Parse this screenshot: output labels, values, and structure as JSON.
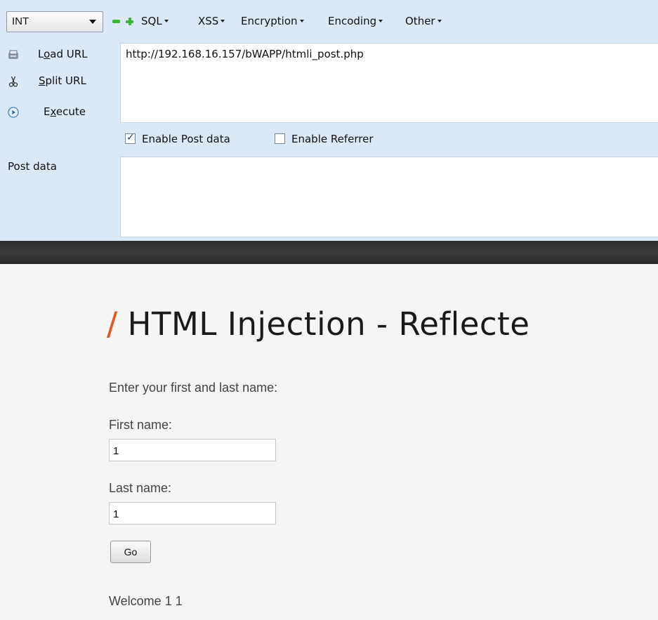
{
  "hackbar": {
    "select_value": "INT",
    "menus": [
      "SQL",
      "XSS",
      "Encryption",
      "Encoding",
      "Other"
    ],
    "load_url": "Load URL",
    "split_url": "Split URL",
    "execute": "Execute",
    "url_value": "http://192.168.16.157/bWAPP/htmli_post.php",
    "enable_post": "Enable Post data",
    "enable_post_checked": true,
    "enable_referrer": "Enable Referrer",
    "enable_referrer_checked": false,
    "post_label": "Post data",
    "post_value": ""
  },
  "page": {
    "title_slash": "/",
    "title": "HTML Injection - Reflecte",
    "prompt": "Enter your first and last name:",
    "first_label": "First name:",
    "first_value": "1",
    "last_label": "Last name:",
    "last_value": "1",
    "go_label": "Go",
    "welcome": "Welcome 1 1"
  },
  "colors": {
    "hackbar_bg": "#dbe8f6",
    "accent_slash": "#e8541c",
    "add_remove_green": "#3bb53b"
  }
}
